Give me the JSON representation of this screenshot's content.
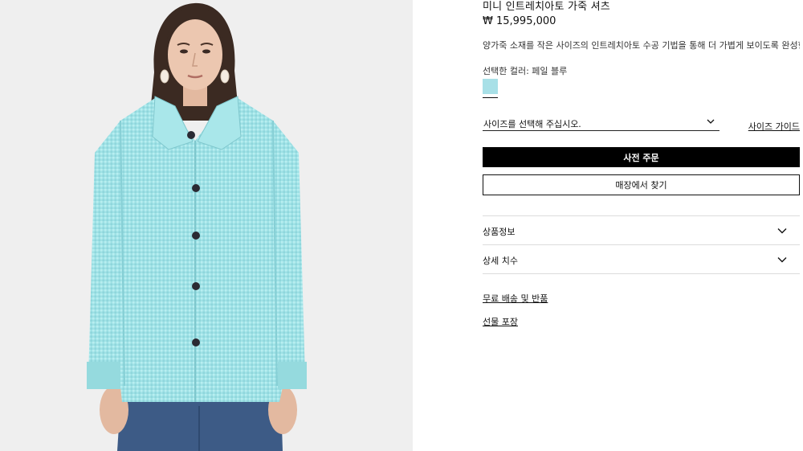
{
  "product": {
    "title": "미니 인트레치아토 가죽 셔츠",
    "price": "₩ 15,995,000",
    "description": "양가죽 소재를 작은 사이즈의 인트레치아토 수공 기법을 통해 더 가볍게 보이도록 완성한 셔츠.",
    "image_alt": "model-wearing-shirt"
  },
  "color": {
    "label": "선택한 컬러: 페일 블루",
    "swatch_color": "#a8e0e7"
  },
  "size": {
    "placeholder": "사이즈를 선택해 주십시오.",
    "guide_label": "사이즈 가이드"
  },
  "actions": {
    "preorder_label": "사전 주문",
    "find_in_store_label": "매장에서 찾기"
  },
  "accordion": [
    {
      "label": "상품정보"
    },
    {
      "label": "상세 치수"
    }
  ],
  "links": {
    "shipping_returns": "무료 배송 및 반품",
    "gift_wrap": "선물 포장"
  },
  "colors": {
    "primary_button_bg": "#000000",
    "image_bg": "#efefef",
    "shirt": "#9ee3e6"
  }
}
